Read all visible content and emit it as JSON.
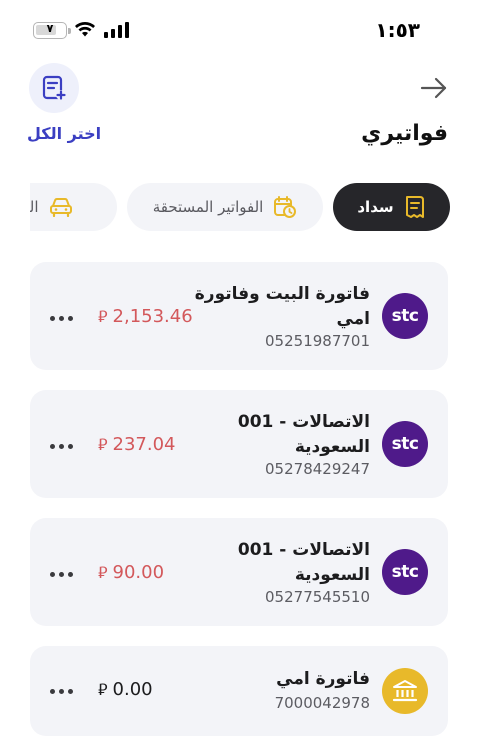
{
  "status_bar": {
    "time": "١:٥٣",
    "battery_level": "٧"
  },
  "header": {
    "title": "فواتيري",
    "select_all": "اختر الكل",
    "icons": {
      "back": "arrow-right-icon",
      "add_invoice": "invoice-add-icon"
    }
  },
  "tabs": [
    {
      "label": "سداد",
      "icon": "receipt-icon",
      "active": true
    },
    {
      "label": "الفواتير المستحقة",
      "icon": "calendar-clock-icon",
      "active": false
    },
    {
      "label": "المخ",
      "icon": "car-icon",
      "active": false
    }
  ],
  "bills": [
    {
      "title": "فاتورة البيت وفاتورة امي",
      "number": "05251987701",
      "amount": "2,153.46",
      "currency": "⃁",
      "logo": "stc",
      "status_color": "#d3585b"
    },
    {
      "title": "001 - الاتصالات السعودية",
      "number": "05278429247",
      "amount": "237.04",
      "currency": "⃁",
      "logo": "stc",
      "status_color": "#d3585b"
    },
    {
      "title": "001 - الاتصالات السعودية",
      "number": "05277545510",
      "amount": "90.00",
      "currency": "⃁",
      "logo": "stc",
      "status_color": "#d3585b"
    },
    {
      "title": "فاتورة امي",
      "number": "7000042978",
      "amount": "0.00",
      "currency": "⃁",
      "logo": "bank",
      "status_color": "#1c1c1e"
    }
  ],
  "logos": {
    "stc_text": "stc"
  },
  "colors": {
    "accent": "#3b3fc2",
    "stc_purple": "#4f1a8a",
    "bank_yellow": "#e8b92a",
    "due_red": "#d3585b",
    "active_tab": "#26262a"
  }
}
